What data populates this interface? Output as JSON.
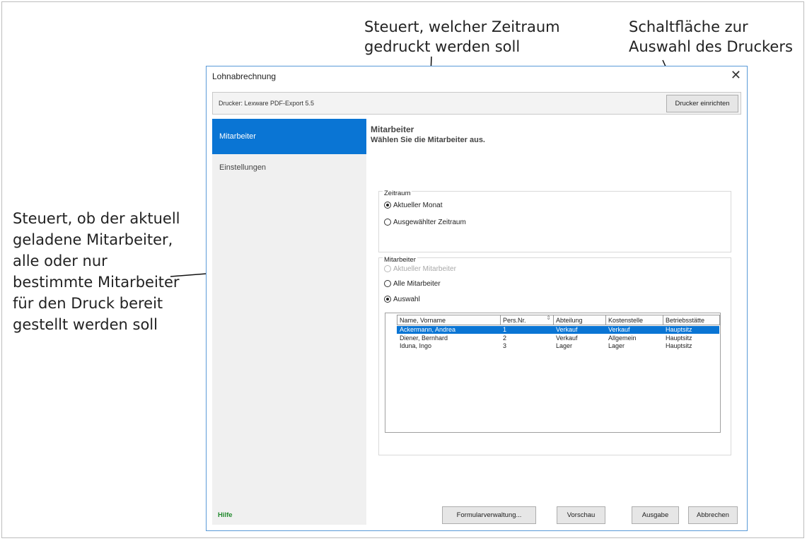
{
  "annotations": {
    "top_center": "Steuert, welcher Zeitraum gedruckt werden soll",
    "top_right": "Schaltfläche zur Auswahl des Druckers",
    "left": "Steuert, ob der aktuell geladene Mitarbeiter, alle oder nur bestimmte Mitarbeiter für den Druck bereit gestellt werden soll"
  },
  "dialog": {
    "title": "Lohnabrechnung",
    "close_glyph": "✕"
  },
  "printer": {
    "label": "Drucker:  Lexware PDF-Export 5.5",
    "button_label": "Drucker einrichten"
  },
  "sidebar": {
    "items": [
      {
        "label": "Mitarbeiter",
        "active": true
      },
      {
        "label": "Einstellungen",
        "active": false
      }
    ]
  },
  "content": {
    "heading": "Mitarbeiter",
    "subheading": "Wählen Sie die Mitarbeiter aus."
  },
  "zeitraum": {
    "title": "Zeitraum",
    "options": [
      {
        "label": "Aktueller Monat",
        "selected": true
      },
      {
        "label": "Ausgewählter Zeitraum",
        "selected": false
      }
    ]
  },
  "mitarbeiter": {
    "title": "Mitarbeiter",
    "options": [
      {
        "label": "Aktueller Mitarbeiter",
        "selected": false,
        "disabled": true
      },
      {
        "label": "Alle Mitarbeiter",
        "selected": false,
        "disabled": false
      },
      {
        "label": "Auswahl",
        "selected": true,
        "disabled": false
      }
    ]
  },
  "table": {
    "columns": [
      "Name, Vorname",
      "Pers.Nr.",
      "Abteilung",
      "Kostenstelle",
      "Betriebsstätte"
    ],
    "sort_icon": "⇕",
    "rows": [
      {
        "cells": [
          "Ackermann, Andrea",
          "1",
          "Verkauf",
          "Verkauf",
          "Hauptsitz"
        ],
        "selected": true
      },
      {
        "cells": [
          "Diener, Bernhard",
          "2",
          "Verkauf",
          "Allgemein",
          "Hauptsitz"
        ],
        "selected": false
      },
      {
        "cells": [
          "Iduna, Ingo",
          "3",
          "Lager",
          "Lager",
          "Hauptsitz"
        ],
        "selected": false
      }
    ]
  },
  "footer": {
    "help": "Hilfe",
    "buttons": {
      "formular": "Formularverwaltung...",
      "preview": "Vorschau",
      "output": "Ausgabe",
      "cancel": "Abbrechen"
    }
  },
  "colors": {
    "accent": "#0a75d4",
    "help_text": "#228a2e",
    "dialog_border": "#5a9ad8"
  }
}
